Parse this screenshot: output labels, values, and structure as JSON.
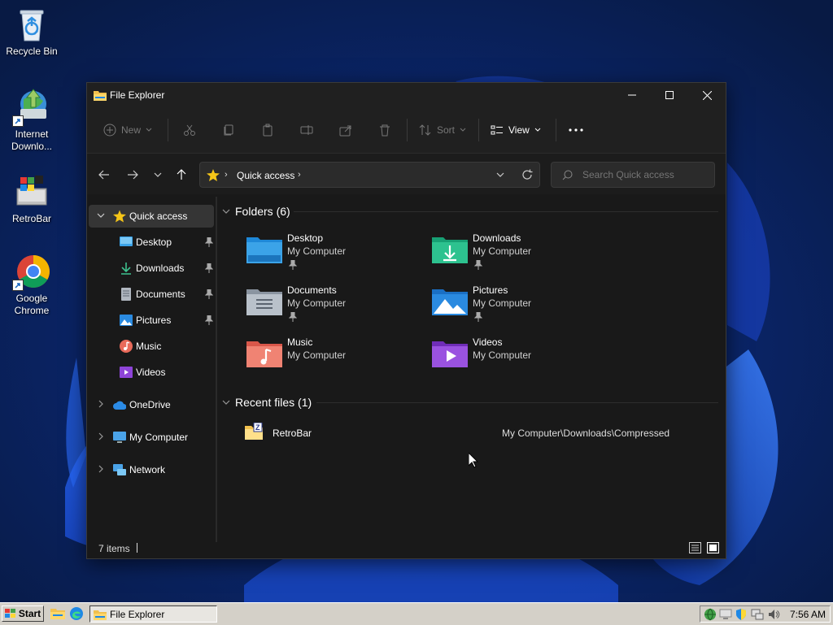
{
  "desktop": {
    "icons": [
      {
        "label": "Recycle Bin",
        "icon": "recycle-bin-icon"
      },
      {
        "label": "Internet Downlo...",
        "icon": "internet-download-manager-icon"
      },
      {
        "label": "RetroBar",
        "icon": "retrobar-icon"
      },
      {
        "label": "Google Chrome",
        "icon": "chrome-icon"
      }
    ]
  },
  "window": {
    "title": "File Explorer",
    "commands": {
      "new": "New",
      "sort": "Sort",
      "view": "View"
    },
    "address": {
      "crumb": "Quick access"
    },
    "search": {
      "placeholder": "Search Quick access"
    },
    "sidebar": {
      "items": [
        {
          "label": "Quick access",
          "icon": "star-icon",
          "selected": true
        },
        {
          "label": "Desktop",
          "icon": "desktop-icon",
          "pinned": true
        },
        {
          "label": "Downloads",
          "icon": "download-icon",
          "pinned": true
        },
        {
          "label": "Documents",
          "icon": "documents-icon",
          "pinned": true
        },
        {
          "label": "Pictures",
          "icon": "pictures-icon",
          "pinned": true
        },
        {
          "label": "Music",
          "icon": "music-icon"
        },
        {
          "label": "Videos",
          "icon": "videos-icon"
        },
        {
          "label": "OneDrive",
          "icon": "cloud-icon"
        },
        {
          "label": "My Computer",
          "icon": "computer-icon"
        },
        {
          "label": "Network",
          "icon": "network-icon"
        }
      ]
    },
    "folders_section": {
      "header": "Folders (6)",
      "folders": [
        {
          "name": "Desktop",
          "location": "My Computer",
          "pinned": true,
          "icon": "desktop-folder-icon"
        },
        {
          "name": "Downloads",
          "location": "My Computer",
          "pinned": true,
          "icon": "downloads-folder-icon"
        },
        {
          "name": "Documents",
          "location": "My Computer",
          "pinned": true,
          "icon": "documents-folder-icon"
        },
        {
          "name": "Pictures",
          "location": "My Computer",
          "pinned": true,
          "icon": "pictures-folder-icon"
        },
        {
          "name": "Music",
          "location": "My Computer",
          "pinned": false,
          "icon": "music-folder-icon"
        },
        {
          "name": "Videos",
          "location": "My Computer",
          "pinned": false,
          "icon": "videos-folder-icon"
        }
      ]
    },
    "recent_section": {
      "header": "Recent files (1)",
      "files": [
        {
          "name": "RetroBar",
          "path": "My Computer\\Downloads\\Compressed",
          "icon": "zip-folder-icon"
        }
      ]
    },
    "status": {
      "item_count": "7 items"
    }
  },
  "taskbar": {
    "start_label": "Start",
    "task_label": "File Explorer",
    "clock": "7:56 AM"
  },
  "colors": {
    "window_bg": "#191919",
    "titlebar_bg": "#202020",
    "selected_bg": "#353535",
    "taskbar_bg": "#d4d0c8",
    "accent_blue": "#1e90ff"
  }
}
